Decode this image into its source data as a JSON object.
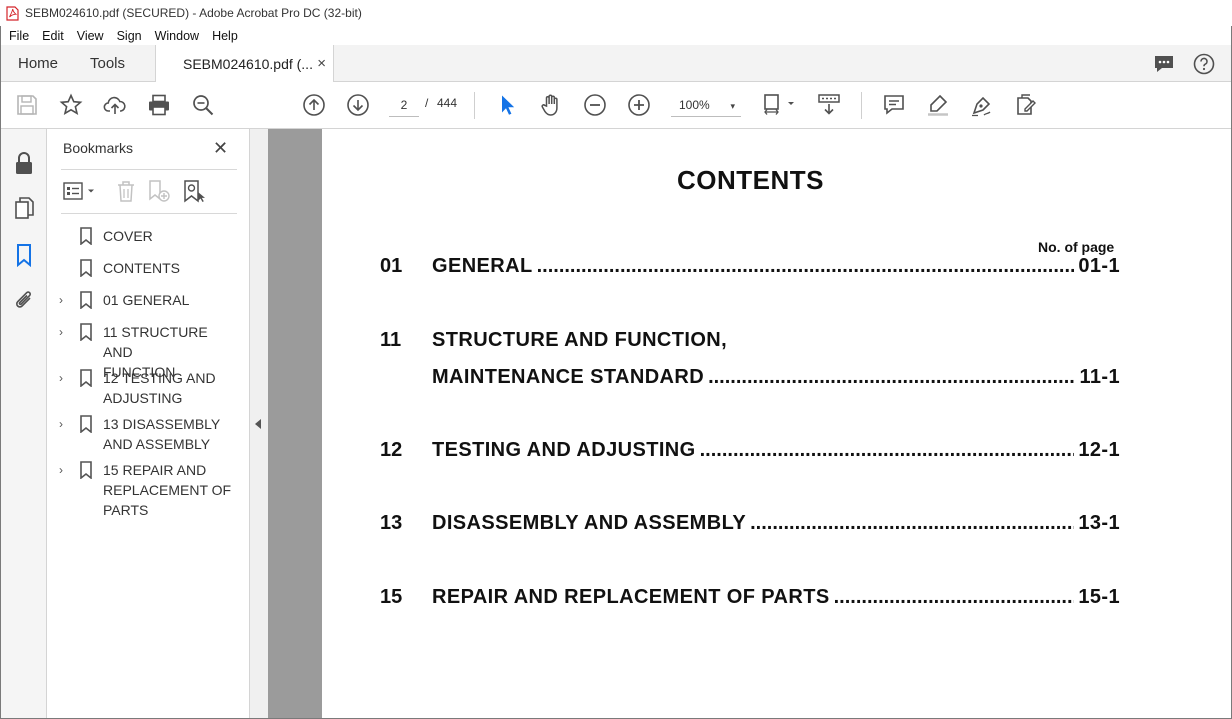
{
  "window": {
    "title": "SEBM024610.pdf (SECURED) - Adobe Acrobat Pro DC (32-bit)"
  },
  "menu": [
    "File",
    "Edit",
    "View",
    "Sign",
    "Window",
    "Help"
  ],
  "tabs": {
    "home": "Home",
    "tools": "Tools",
    "document": "SEBM024610.pdf (...",
    "close_glyph": "×"
  },
  "toolbar": {
    "current_page": "2",
    "page_separator": "/",
    "total_pages": "444",
    "zoom": "100%",
    "zoom_caret": "▾"
  },
  "bookmarks": {
    "header": "Bookmarks",
    "close_glyph": "✕",
    "items": [
      {
        "label": "COVER",
        "expandable": false
      },
      {
        "label": "CONTENTS",
        "expandable": false
      },
      {
        "label": "01 GENERAL",
        "expandable": true
      },
      {
        "label": "11 STRUCTURE AND FUNCTION",
        "expandable": true
      },
      {
        "label": "12 TESTING AND ADJUSTING",
        "expandable": true
      },
      {
        "label": "13 DISASSEMBLY AND ASSEMBLY",
        "expandable": true
      },
      {
        "label": "15 REPAIR AND REPLACEMENT OF PARTS",
        "expandable": true
      }
    ],
    "chevron_glyph": "›"
  },
  "document": {
    "title": "CONTENTS",
    "page_column_header": "No. of page",
    "entries": [
      {
        "num": "01",
        "line1": "",
        "title": "GENERAL",
        "page": "01-1"
      },
      {
        "num": "11",
        "line1": "STRUCTURE AND FUNCTION,",
        "title": "MAINTENANCE STANDARD",
        "page": "11-1"
      },
      {
        "num": "12",
        "line1": "",
        "title": "TESTING AND ADJUSTING",
        "page": "12-1"
      },
      {
        "num": "13",
        "line1": "",
        "title": "DISASSEMBLY AND ASSEMBLY",
        "page": "13-1"
      },
      {
        "num": "15",
        "line1": "",
        "title": "REPAIR AND REPLACEMENT OF PARTS",
        "page": "15-1"
      }
    ]
  },
  "colors": {
    "accent_blue": "#1473e6",
    "icon_gray": "#505050",
    "doc_gutter": "#9b9b9b",
    "pdf_icon_red": "#d4242a"
  }
}
